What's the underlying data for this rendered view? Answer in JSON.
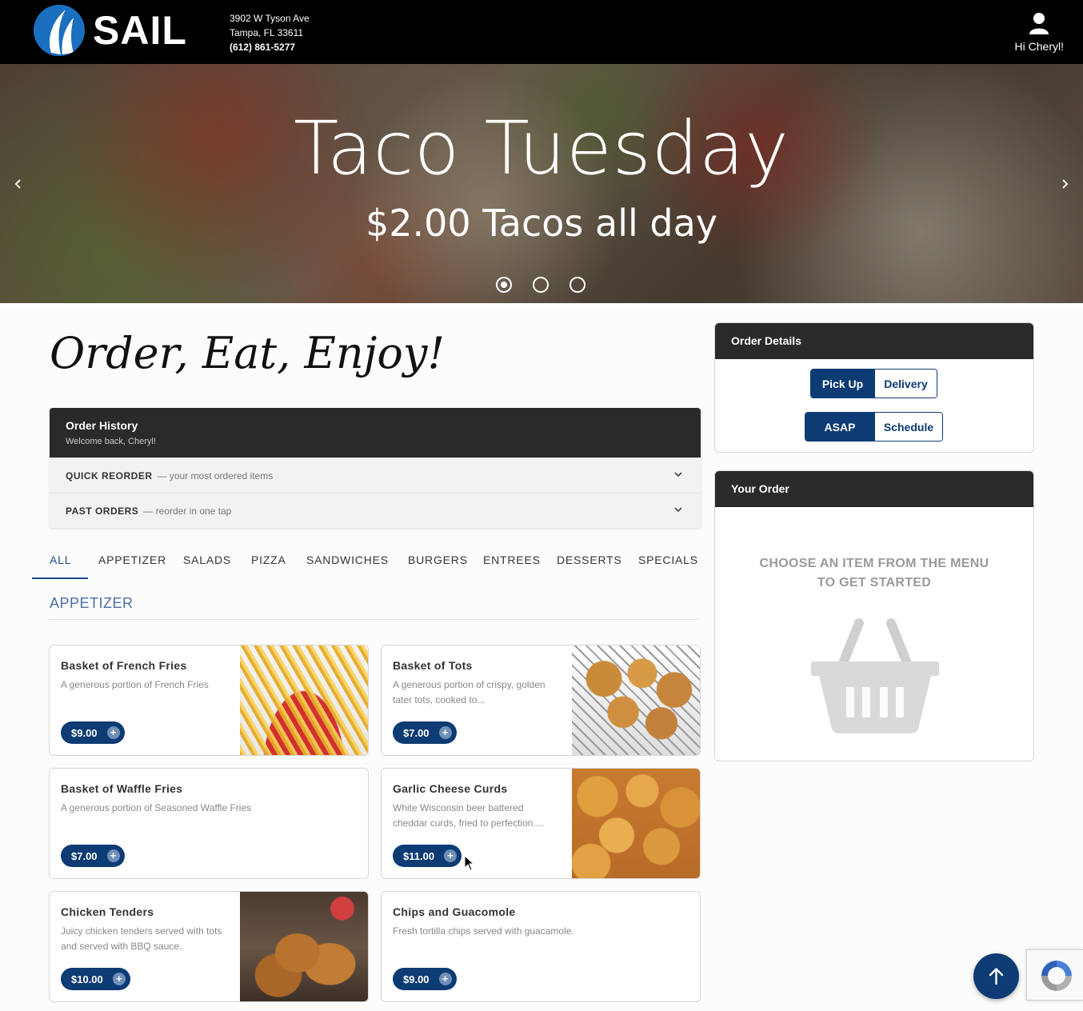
{
  "brand": {
    "name": "SAIL",
    "accent": "#0d3b73",
    "logo_blue": "#1a6fbf"
  },
  "header": {
    "address_line1": "3902 W Tyson Ave",
    "address_line2": "Tampa, FL 33611",
    "phone": "(612) 861-5277",
    "greeting": "Hi Cheryl!",
    "user_icon": "user-icon"
  },
  "hero": {
    "title": "Taco Tuesday",
    "subtitle": "$2.00 Tacos all day",
    "prev_icon": "chevron-left-icon",
    "next_icon": "chevron-right-icon",
    "slide_count": 3,
    "active_slide": 1
  },
  "tagline": "Order, Eat, Enjoy!",
  "order_history": {
    "title": "Order History",
    "subtitle": "Welcome back, Cheryl!",
    "sections": [
      {
        "label": "QUICK REORDER",
        "desc": "— your most ordered items"
      },
      {
        "label": "PAST ORDERS",
        "desc": "— reorder in one tap"
      }
    ]
  },
  "tabs": [
    {
      "label": "ALL",
      "active": true
    },
    {
      "label": "APPETIZER"
    },
    {
      "label": "SALADS"
    },
    {
      "label": "PIZZA"
    },
    {
      "label": "SANDWICHES"
    },
    {
      "label": "BURGERS"
    },
    {
      "label": "ENTREES"
    },
    {
      "label": "DESSERTS"
    },
    {
      "label": "SPECIALS"
    }
  ],
  "section_title": "APPETIZER",
  "menu_items": [
    {
      "name": "Basket of French Fries",
      "desc": "A generous portion of French Fries",
      "price": "$9.00",
      "image": "french-fries"
    },
    {
      "name": "Basket of Tots",
      "desc": "A generous portion of crispy, golden tater tots, cooked to...",
      "price": "$7.00",
      "image": "tater-tots"
    },
    {
      "name": "Basket of Waffle Fries",
      "desc": "A generous portion of Seasoned Waffle Fries",
      "price": "$7.00",
      "image": null
    },
    {
      "name": "Garlic Cheese Curds",
      "desc": "White Wisconsin beer battered cheddar curds, fried to perfection....",
      "price": "$11.00",
      "image": "cheese-curds"
    },
    {
      "name": "Chicken Tenders",
      "desc": "Juicy chicken tenders served with tots and served with BBQ sauce.",
      "price": "$10.00",
      "image": "chicken-tenders"
    },
    {
      "name": "Chips and Guacomole",
      "desc": "Fresh tortilla chips served with guacamole.",
      "price": "$9.00",
      "image": null
    }
  ],
  "order_details": {
    "title": "Order Details",
    "method_options": [
      "Pick Up",
      "Delivery"
    ],
    "method_selected": "Pick Up",
    "time_options": [
      "ASAP",
      "Schedule"
    ],
    "time_selected": "ASAP"
  },
  "your_order": {
    "title": "Your Order",
    "empty_line1": "CHOOSE AN ITEM FROM THE MENU",
    "empty_line2": "TO GET STARTED",
    "empty_icon": "shopping-basket-icon"
  },
  "floating": {
    "scroll_top_icon": "arrow-up-icon",
    "recaptcha_icon": "recaptcha-icon"
  }
}
